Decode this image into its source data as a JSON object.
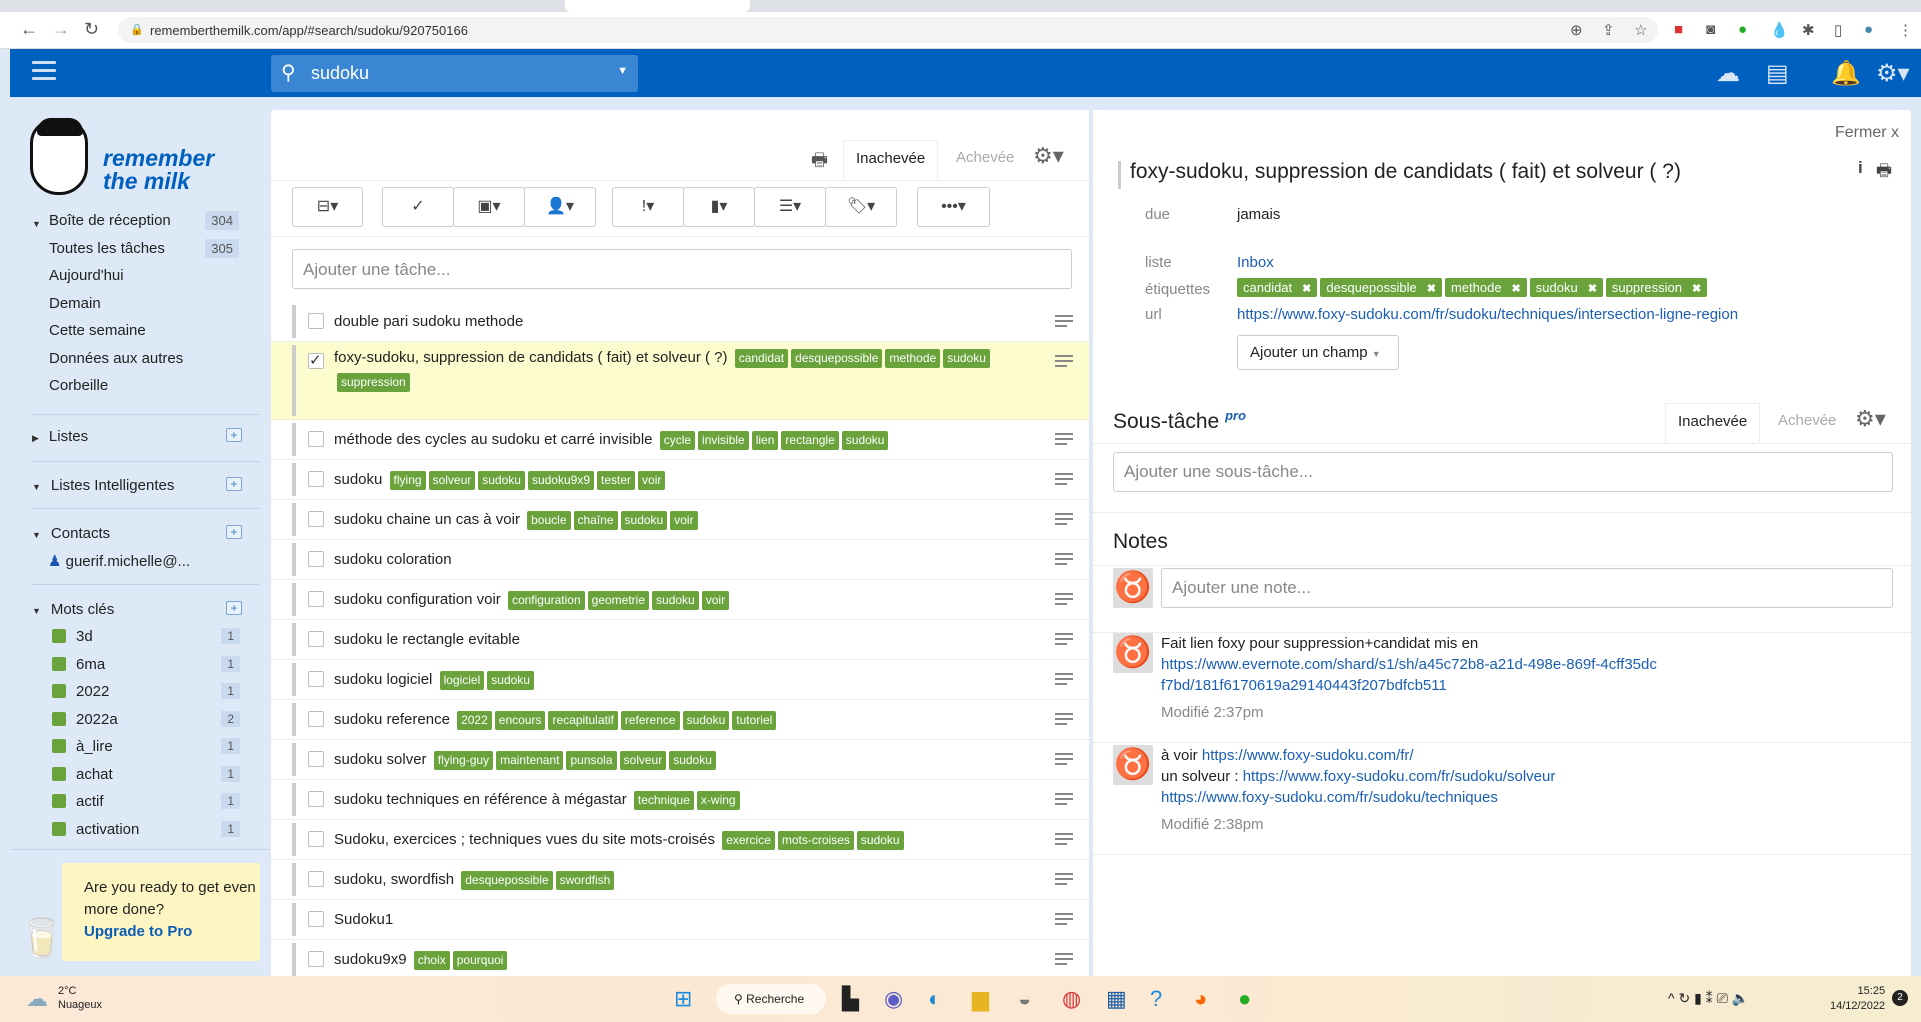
{
  "browser": {
    "url": "rememberthemilk.com/app/#search/sudoku/920750166"
  },
  "header": {
    "search_value": "sudoku"
  },
  "logo": {
    "line1": "remember",
    "line2": "the milk"
  },
  "sidebar": {
    "items": [
      {
        "label": "Boîte de réception",
        "count": "304"
      },
      {
        "label": "Toutes les tâches",
        "count": "305"
      },
      {
        "label": "Aujourd'hui"
      },
      {
        "label": "Demain"
      },
      {
        "label": "Cette semaine"
      },
      {
        "label": "Données aux autres"
      },
      {
        "label": "Corbeille"
      }
    ],
    "sections": {
      "lists": "Listes",
      "smart": "Listes Intelligentes",
      "contacts": "Contacts",
      "tags": "Mots clés"
    },
    "contact": "guerif.michelle@...",
    "tags": [
      {
        "name": "3d",
        "count": "1"
      },
      {
        "name": "6ma",
        "count": "1"
      },
      {
        "name": "2022",
        "count": "1"
      },
      {
        "name": "2022a",
        "count": "2"
      },
      {
        "name": "à_lire",
        "count": "1"
      },
      {
        "name": "achat",
        "count": "1"
      },
      {
        "name": "actif",
        "count": "1"
      },
      {
        "name": "activation",
        "count": "1"
      }
    ],
    "promo": {
      "text": "Are you ready to get even more done?",
      "link": "Upgrade to Pro"
    }
  },
  "tasks": {
    "tab_incomplete": "Inachevée",
    "tab_complete": "Achevée",
    "add_placeholder": "Ajouter une tâche...",
    "rows": [
      {
        "title": "double pari sudoku methode",
        "tags": []
      },
      {
        "title": "foxy-sudoku, suppression de candidats ( fait) et solveur ( ?)",
        "tags": [
          "candidat",
          "desquepossible",
          "methode",
          "sudoku",
          "suppression"
        ],
        "checked": true
      },
      {
        "title": "méthode des cycles au sudoku et carré invisible",
        "tags": [
          "cycle",
          "invisible",
          "lien",
          "rectangle",
          "sudoku"
        ]
      },
      {
        "title": "sudoku",
        "tags": [
          "flying",
          "solveur",
          "sudoku",
          "sudoku9x9",
          "tester",
          "voir"
        ]
      },
      {
        "title": "sudoku chaine un cas à voir",
        "tags": [
          "boucle",
          "chaîne",
          "sudoku",
          "voir"
        ]
      },
      {
        "title": "sudoku coloration",
        "tags": []
      },
      {
        "title": "sudoku configuration voir",
        "tags": [
          "configuration",
          "geometrie",
          "sudoku",
          "voir"
        ]
      },
      {
        "title": "sudoku le rectangle evitable",
        "tags": []
      },
      {
        "title": "sudoku logiciel",
        "tags": [
          "logiciel",
          "sudoku"
        ]
      },
      {
        "title": "sudoku reference",
        "tags": [
          "2022",
          "encours",
          "recapitulatif",
          "reference",
          "sudoku",
          "tutoriel"
        ]
      },
      {
        "title": "sudoku solver",
        "tags": [
          "flying-guy",
          "maintenant",
          "punsola",
          "solveur",
          "sudoku"
        ]
      },
      {
        "title": "sudoku techniques en référence à mégastar",
        "tags": [
          "technique",
          "x-wing"
        ]
      },
      {
        "title": "Sudoku, exercices ; techniques vues du site mots-croisés",
        "tags": [
          "exercice",
          "mots-croises",
          "sudoku"
        ]
      },
      {
        "title": "sudoku, swordfish",
        "tags": [
          "desquepossible",
          "swordfish"
        ]
      },
      {
        "title": "Sudoku1",
        "tags": []
      },
      {
        "title": "sudoku9x9",
        "tags": [
          "choix",
          "pourquoi"
        ]
      }
    ]
  },
  "detail": {
    "close": "Fermer x",
    "title": "foxy-sudoku, suppression de candidats ( fait) et solveur ( ?)",
    "due_label": "due",
    "due": "jamais",
    "list_label": "liste",
    "list": "Inbox",
    "tags_label": "étiquettes",
    "tags": [
      "candidat",
      "desquepossible",
      "methode",
      "sudoku",
      "suppression"
    ],
    "url_label": "url",
    "url": "https://www.foxy-sudoku.com/fr/sudoku/techniques/intersection-ligne-region",
    "add_field": "Ajouter un champ",
    "subtask_title": "Sous-tâche",
    "pro": "pro",
    "tab_incomplete": "Inachevée",
    "tab_complete": "Achevée",
    "subtask_placeholder": "Ajouter une sous-tâche...",
    "notes_title": "Notes",
    "note_placeholder": "Ajouter une note...",
    "notes": [
      {
        "text": "Fait lien foxy  pour suppression+candidat   mis en",
        "link": "https://www.evernote.com/shard/s1/sh/a45c72b8-a21d-498e-869f-4cff35dcf7bd/181f6170619a29140443f207bdfcb511",
        "modified": "Modifié 2:37pm"
      },
      {
        "prefix": "à voir",
        "link1": "https://www.foxy-sudoku.com/fr/",
        "prefix2": "un solveur :",
        "link2": "https://www.foxy-sudoku.com/fr/sudoku/solveur",
        "link3": "https://www.foxy-sudoku.com/fr/sudoku/techniques",
        "modified": "Modifié 2:38pm"
      }
    ]
  },
  "taskbar": {
    "temp": "2°C",
    "weather": "Nuageux",
    "search": "Recherche",
    "time": "15:25",
    "date": "14/12/2022",
    "badge": "2"
  }
}
